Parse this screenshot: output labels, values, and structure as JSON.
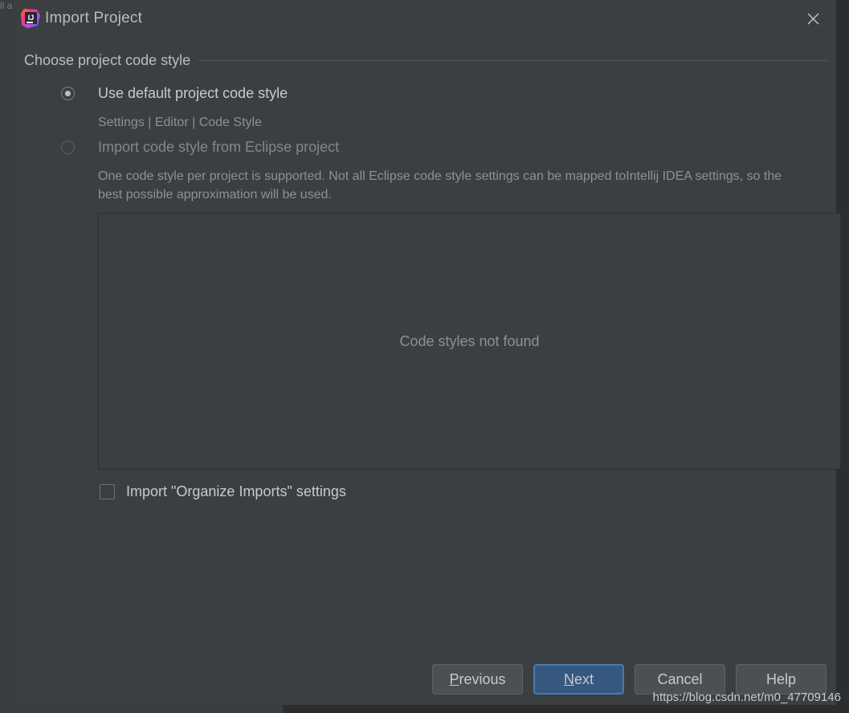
{
  "window": {
    "title": "Import Project",
    "logo_icon": "intellij-idea-logo",
    "close_icon": "close-icon"
  },
  "content": {
    "group_header": "Choose project code style",
    "options": [
      {
        "id": "use-default",
        "label": "Use default project code style",
        "selected": true,
        "enabled": true,
        "hint": "Settings | Editor | Code Style"
      },
      {
        "id": "import-eclipse",
        "label": "Import code style from Eclipse project",
        "selected": false,
        "enabled": false,
        "description": "One code style per project is supported. Not all Eclipse code style settings can be mapped toIntellij IDEA settings, so the best possible approximation will be used."
      }
    ],
    "code_styles_panel": {
      "empty_text": "Code styles not found"
    },
    "organize_imports": {
      "label": "Import \"Organize Imports\" settings",
      "checked": false
    }
  },
  "footer": {
    "buttons": [
      {
        "id": "previous",
        "label": "Previous",
        "mnemonic": "P",
        "default": false
      },
      {
        "id": "next",
        "label": "Next",
        "mnemonic": "N",
        "default": true
      },
      {
        "id": "cancel",
        "label": "Cancel",
        "mnemonic": "",
        "default": false
      },
      {
        "id": "help",
        "label": "Help",
        "mnemonic": "",
        "default": false
      }
    ]
  },
  "watermark": "https://blog.csdn.net/m0_47709146",
  "background_fragments": "ll\na",
  "colors": {
    "dialog_background": "#3c3f41",
    "panel_border": "#2d2f31",
    "text_primary": "#c6cace",
    "text_secondary": "#8d9194",
    "title_text": "#b9bdc0",
    "button_background": "#4c5052",
    "default_button_background": "#365880",
    "default_button_border": "#4a7ab0",
    "separator": "#53575a"
  }
}
